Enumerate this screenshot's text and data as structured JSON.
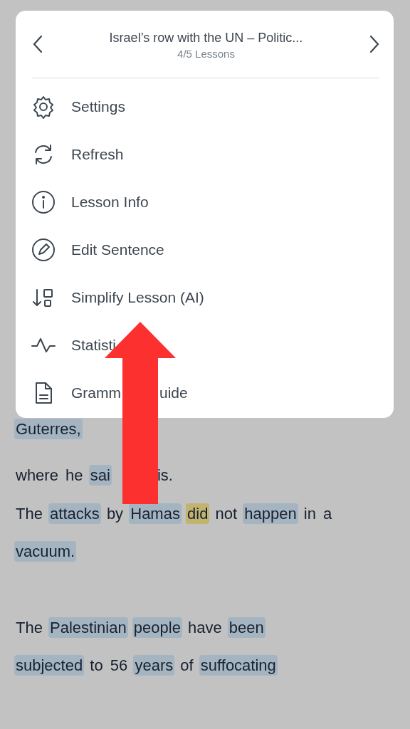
{
  "menu": {
    "title": "Israel’s row with the UN – Politic...",
    "subtitle": "4/5 Lessons",
    "items": [
      {
        "kind": "gear",
        "label_parts": [
          "Settings"
        ]
      },
      {
        "kind": "refresh",
        "label_parts": [
          "Refresh"
        ]
      },
      {
        "kind": "info",
        "label_parts": [
          "Lesson Info"
        ]
      },
      {
        "kind": "pencil",
        "label_parts": [
          "Edit Sentence"
        ]
      },
      {
        "kind": "simplify",
        "label_parts": [
          "Simplify Lesson (AI)"
        ]
      },
      {
        "kind": "pulse",
        "label_parts": [
          "Statisti"
        ]
      },
      {
        "kind": "document",
        "label_parts": [
          "Gramm",
          "uide"
        ]
      }
    ]
  },
  "lesson": {
    "paragraphs": [
      {
        "lines": [
          [
            {
              "text": "Guterres,",
              "kind": "known"
            }
          ]
        ]
      },
      {
        "lines": [
          [
            {
              "text": "where",
              "kind": "plain"
            },
            {
              "text": "he",
              "kind": "plain"
            },
            {
              "text": "sai",
              "kind": "known",
              "covered_after": true
            },
            {
              "text": "is.",
              "kind": "plain"
            }
          ]
        ]
      },
      {
        "lines": [
          [
            {
              "text": "The",
              "kind": "plain"
            },
            {
              "text": "attacks",
              "kind": "known"
            },
            {
              "text": "by",
              "kind": "plain"
            },
            {
              "text": "Hamas",
              "kind": "known"
            },
            {
              "text": "did",
              "kind": "focus"
            },
            {
              "text": "not",
              "kind": "plain"
            },
            {
              "text": "happen",
              "kind": "known"
            },
            {
              "text": "in",
              "kind": "plain"
            },
            {
              "text": "a",
              "kind": "plain"
            }
          ],
          [
            {
              "text": "vacuum.",
              "kind": "known"
            }
          ]
        ]
      },
      {
        "lines": [
          [
            {
              "text": "The",
              "kind": "plain"
            },
            {
              "text": "Palestinian",
              "kind": "known"
            },
            {
              "text": "people",
              "kind": "known"
            },
            {
              "text": "have",
              "kind": "plain"
            },
            {
              "text": "been",
              "kind": "known"
            }
          ],
          [
            {
              "text": "subjected",
              "kind": "known"
            },
            {
              "text": "to",
              "kind": "plain"
            },
            {
              "text": "56",
              "kind": "plain"
            },
            {
              "text": "years",
              "kind": "known"
            },
            {
              "text": "of",
              "kind": "plain"
            },
            {
              "text": "suffocating",
              "kind": "known"
            }
          ]
        ]
      }
    ]
  }
}
